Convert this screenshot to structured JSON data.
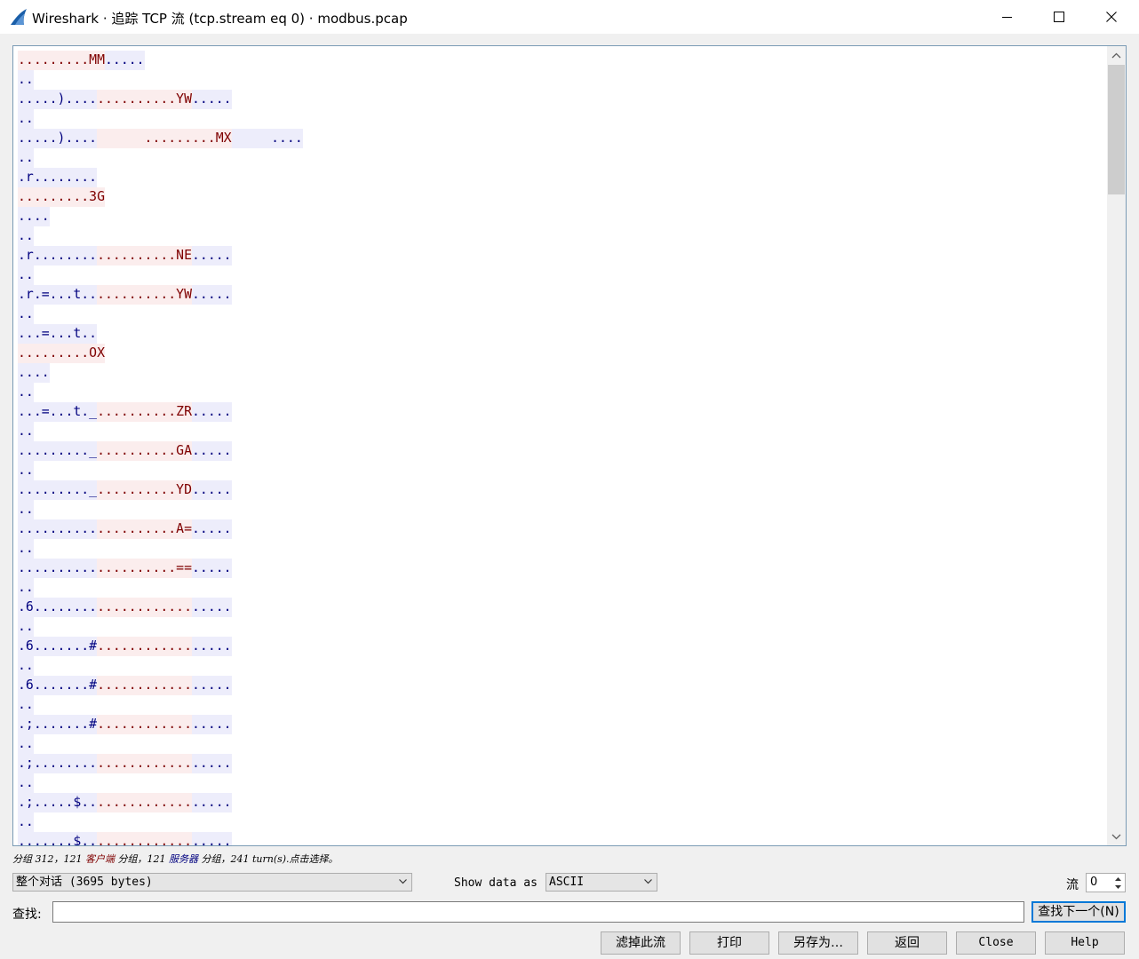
{
  "window": {
    "title": "Wireshark · 追踪 TCP 流 (tcp.stream eq 0) · modbus.pcap"
  },
  "stream_lines": [
    [
      {
        "t": "c",
        "text": ".........MM"
      },
      {
        "t": "s",
        "text": "....."
      }
    ],
    [
      {
        "t": "s",
        "text": ".."
      }
    ],
    [
      {
        "t": "s",
        "text": ".....)...."
      },
      {
        "t": "c",
        "text": "..........YW"
      },
      {
        "t": "s",
        "text": "....."
      }
    ],
    [
      {
        "t": "s",
        "text": ".."
      }
    ],
    [
      {
        "t": "s",
        "text": ".....)...."
      },
      {
        "t": "c",
        "text": "      .........MX"
      },
      {
        "t": "s",
        "text": "     ...."
      }
    ],
    [
      {
        "t": "s",
        "text": ".."
      }
    ],
    [
      {
        "t": "s",
        "text": ".r........"
      }
    ],
    [
      {
        "t": "c",
        "text": ".........3G"
      }
    ],
    [
      {
        "t": "s",
        "text": "...."
      }
    ],
    [
      {
        "t": "s",
        "text": ".."
      }
    ],
    [
      {
        "t": "s",
        "text": ".r........"
      },
      {
        "t": "c",
        "text": "..........NE"
      },
      {
        "t": "s",
        "text": "....."
      }
    ],
    [
      {
        "t": "s",
        "text": ".."
      }
    ],
    [
      {
        "t": "s",
        "text": ".r.=...t.."
      },
      {
        "t": "c",
        "text": "..........YW"
      },
      {
        "t": "s",
        "text": "....."
      }
    ],
    [
      {
        "t": "s",
        "text": ".."
      }
    ],
    [
      {
        "t": "s",
        "text": "...=...t.."
      }
    ],
    [
      {
        "t": "c",
        "text": ".........OX"
      }
    ],
    [
      {
        "t": "s",
        "text": "...."
      }
    ],
    [
      {
        "t": "s",
        "text": ".."
      }
    ],
    [
      {
        "t": "s",
        "text": "...=...t._"
      },
      {
        "t": "c",
        "text": "..........ZR"
      },
      {
        "t": "s",
        "text": "....."
      }
    ],
    [
      {
        "t": "s",
        "text": ".."
      }
    ],
    [
      {
        "t": "s",
        "text": "........._"
      },
      {
        "t": "c",
        "text": "..........GA"
      },
      {
        "t": "s",
        "text": "....."
      }
    ],
    [
      {
        "t": "s",
        "text": ".."
      }
    ],
    [
      {
        "t": "s",
        "text": "........._"
      },
      {
        "t": "c",
        "text": "..........YD"
      },
      {
        "t": "s",
        "text": "....."
      }
    ],
    [
      {
        "t": "s",
        "text": ".."
      }
    ],
    [
      {
        "t": "s",
        "text": ".........."
      },
      {
        "t": "c",
        "text": "..........A="
      },
      {
        "t": "s",
        "text": "....."
      }
    ],
    [
      {
        "t": "s",
        "text": ".."
      }
    ],
    [
      {
        "t": "s",
        "text": ".........."
      },
      {
        "t": "c",
        "text": "..........=="
      },
      {
        "t": "s",
        "text": "....."
      }
    ],
    [
      {
        "t": "s",
        "text": ".."
      }
    ],
    [
      {
        "t": "s",
        "text": ".6........"
      },
      {
        "t": "c",
        "text": "............"
      },
      {
        "t": "s",
        "text": "....."
      }
    ],
    [
      {
        "t": "s",
        "text": ".."
      }
    ],
    [
      {
        "t": "s",
        "text": ".6.......#"
      },
      {
        "t": "c",
        "text": "............"
      },
      {
        "t": "s",
        "text": "....."
      }
    ],
    [
      {
        "t": "s",
        "text": ".."
      }
    ],
    [
      {
        "t": "s",
        "text": ".6.......#"
      },
      {
        "t": "c",
        "text": "............"
      },
      {
        "t": "s",
        "text": "....."
      }
    ],
    [
      {
        "t": "s",
        "text": ".."
      }
    ],
    [
      {
        "t": "s",
        "text": ".;.......#"
      },
      {
        "t": "c",
        "text": "............"
      },
      {
        "t": "s",
        "text": "....."
      }
    ],
    [
      {
        "t": "s",
        "text": ".."
      }
    ],
    [
      {
        "t": "s",
        "text": ".;........"
      },
      {
        "t": "c",
        "text": "............"
      },
      {
        "t": "s",
        "text": "....."
      }
    ],
    [
      {
        "t": "s",
        "text": ".."
      }
    ],
    [
      {
        "t": "s",
        "text": ".;.....$.."
      },
      {
        "t": "c",
        "text": "............"
      },
      {
        "t": "s",
        "text": "....."
      }
    ],
    [
      {
        "t": "s",
        "text": ".."
      }
    ],
    [
      {
        "t": "s",
        "text": ".......$.."
      },
      {
        "t": "c",
        "text": "............"
      },
      {
        "t": "s",
        "text": "....."
      }
    ]
  ],
  "summary": {
    "part1": "分组 312，121 ",
    "client": "客户端",
    "part2": " 分组，121 ",
    "server": "服务器",
    "part3": " 分组，241 turn(s).点击选择。"
  },
  "controls": {
    "conversation": "整个对话 (3695 bytes)",
    "show_as_label": "Show data as",
    "format": "ASCII",
    "stream_label": "流",
    "stream_value": "0",
    "find_label": "查找:",
    "find_value": "",
    "find_next": "查找下一个(N)"
  },
  "buttons": {
    "filter_out": "滤掉此流",
    "print": "打印",
    "save_as": "另存为…",
    "back": "返回",
    "close": "Close",
    "help": "Help"
  },
  "colors": {
    "client_bg": "#fbeded",
    "client_fg": "#7f0000",
    "server_bg": "#ededfb",
    "server_fg": "#00007f",
    "focus": "#0078d7"
  }
}
